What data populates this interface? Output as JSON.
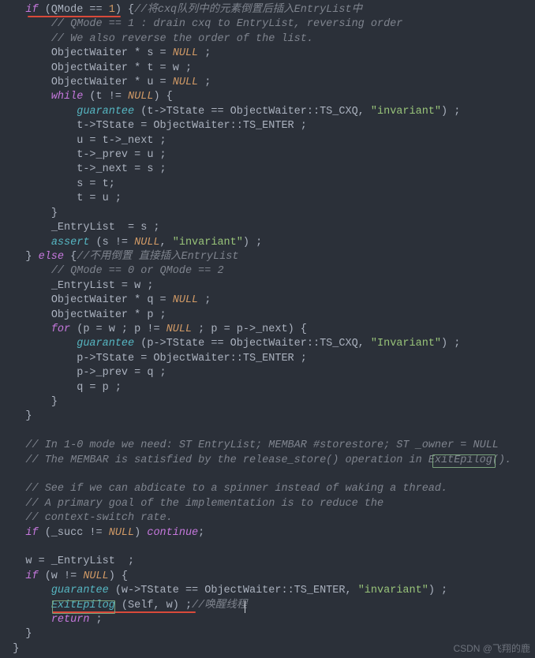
{
  "code": {
    "l01": {
      "indent": "    ",
      "kw_if": "if",
      "cond_open": " (QMode ",
      "eq": "==",
      "sp": " ",
      "one": "1",
      "close_brace": ") {",
      "cmt": "//将cxq队列中的元素倒置后插入EntryList中"
    },
    "l02": {
      "indent": "        ",
      "cmt": "// QMode == 1 : drain cxq to EntryList, reversing order"
    },
    "l03": {
      "indent": "        ",
      "cmt": "// We also reverse the order of the list."
    },
    "l04": {
      "indent": "        ",
      "txt": "ObjectWaiter * s = ",
      "null": "NULL",
      "end": " ;"
    },
    "l05": {
      "indent": "        ",
      "txt": "ObjectWaiter * t = w ;"
    },
    "l06": {
      "indent": "        ",
      "txt": "ObjectWaiter * u = ",
      "null": "NULL",
      "end": " ;"
    },
    "l07": {
      "indent": "        ",
      "kw": "while",
      "txt1": " (t ",
      "neq": "!=",
      "sp": " ",
      "null": "NULL",
      "txt2": ") {"
    },
    "l08": {
      "indent": "            ",
      "fn": "guarantee",
      "txt": " (t->TState == ObjectWaiter::TS_CXQ, ",
      "str": "\"invariant\"",
      "end": ") ;"
    },
    "l09": {
      "indent": "            ",
      "txt": "t->TState = ObjectWaiter::TS_ENTER ;"
    },
    "l10": {
      "indent": "            ",
      "txt": "u = t->_next ;"
    },
    "l11": {
      "indent": "            ",
      "txt": "t->_prev = u ;"
    },
    "l12": {
      "indent": "            ",
      "txt": "t->_next = s ;"
    },
    "l13": {
      "indent": "            ",
      "txt": "s = t;"
    },
    "l14": {
      "indent": "            ",
      "txt": "t = u ;"
    },
    "l15": {
      "indent": "        ",
      "txt": "}"
    },
    "l16": {
      "indent": "        ",
      "txt": "_EntryList  = s ;"
    },
    "l17": {
      "indent": "        ",
      "fn": "assert",
      "txt1": " (s ",
      "neq": "!=",
      "sp": " ",
      "null": "NULL",
      "txt2": ", ",
      "str": "\"invariant\"",
      "end": ") ;"
    },
    "l18": {
      "indent": "    ",
      "txt1": "} ",
      "kw": "else",
      "txt2": " {",
      "cmt": "//不用倒置 直接插入EntryList"
    },
    "l19": {
      "indent": "        ",
      "cmt": "// QMode == 0 or QMode == 2"
    },
    "l20": {
      "indent": "        ",
      "txt": "_EntryList = w ;"
    },
    "l21": {
      "indent": "        ",
      "txt": "ObjectWaiter * q = ",
      "null": "NULL",
      "end": " ;"
    },
    "l22": {
      "indent": "        ",
      "txt": "ObjectWaiter * p ;"
    },
    "l23": {
      "indent": "        ",
      "kw": "for",
      "txt1": " (p = w ; p ",
      "neq": "!=",
      "sp": " ",
      "null": "NULL",
      "txt2": " ; p = p->_next) {"
    },
    "l24": {
      "indent": "            ",
      "fn": "guarantee",
      "txt": " (p->TState == ObjectWaiter::TS_CXQ, ",
      "str": "\"Invariant\"",
      "end": ") ;"
    },
    "l25": {
      "indent": "            ",
      "txt": "p->TState = ObjectWaiter::TS_ENTER ;"
    },
    "l26": {
      "indent": "            ",
      "txt": "p->_prev = q ;"
    },
    "l27": {
      "indent": "            ",
      "txt": "q = p ;"
    },
    "l28": {
      "indent": "        ",
      "txt": "}"
    },
    "l29": {
      "indent": "    ",
      "txt": "}"
    },
    "l30": {
      "txt": " "
    },
    "l31": {
      "indent": "    ",
      "cmt": "// In 1-0 mode we need: ST EntryList; MEMBAR #storestore; ST _owner = NULL"
    },
    "l32": {
      "indent": "    ",
      "cmt1": "// The MEMBAR is satisfied by the release_store() operation in ",
      "cmt2": "ExitEpilog",
      "cmt3": "()."
    },
    "l33": {
      "txt": " "
    },
    "l34": {
      "indent": "    ",
      "cmt": "// See if we can abdicate to a spinner instead of waking a thread."
    },
    "l35": {
      "indent": "    ",
      "cmt": "// A primary goal of the implementation is to reduce the"
    },
    "l36": {
      "indent": "    ",
      "cmt": "// context-switch rate."
    },
    "l37": {
      "indent": "    ",
      "kw": "if",
      "txt1": " (_succ ",
      "neq": "!=",
      "sp": " ",
      "null": "NULL",
      "txt2": ") ",
      "kw2": "continue",
      "end": ";"
    },
    "l38": {
      "txt": " "
    },
    "l39": {
      "indent": "    ",
      "txt": "w = _EntryList  ;"
    },
    "l40": {
      "indent": "    ",
      "kw": "if",
      "txt1": " (w ",
      "neq": "!=",
      "sp": " ",
      "null": "NULL",
      "txt2": ") {"
    },
    "l41": {
      "indent": "        ",
      "fn": "guarantee",
      "txt": " (w->TState == ObjectWaiter::TS_ENTER, ",
      "str": "\"invariant\"",
      "end": ") ;"
    },
    "l42": {
      "indent": "        ",
      "fn": "ExitEpilog",
      "txt": " (Self, w) ;",
      "cmt": "//唤醒线程"
    },
    "l43": {
      "indent": "        ",
      "kw": "return",
      "end": " ;"
    },
    "l44": {
      "indent": "    ",
      "txt": "}"
    },
    "l45": {
      "indent": "  ",
      "txt": "}"
    }
  },
  "watermark": "CSDN @飞翔的鹿"
}
